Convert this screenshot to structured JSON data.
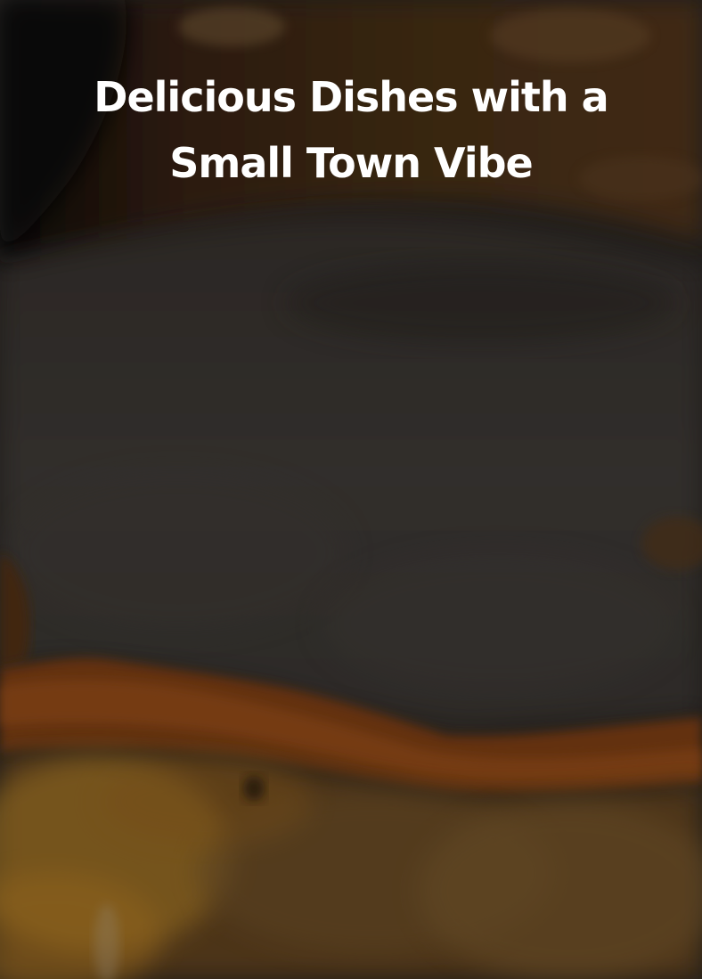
{
  "hero": {
    "title": "Delicious Dishes with a Small Town Vibe",
    "background_image": "close-up-food-photo-dark-overlay",
    "colors": {
      "title_text": "#ffffff",
      "overlay_tone": "#2a2623",
      "crust_orange": "#a8561c",
      "yolk_yellow": "#d39a2e"
    }
  }
}
